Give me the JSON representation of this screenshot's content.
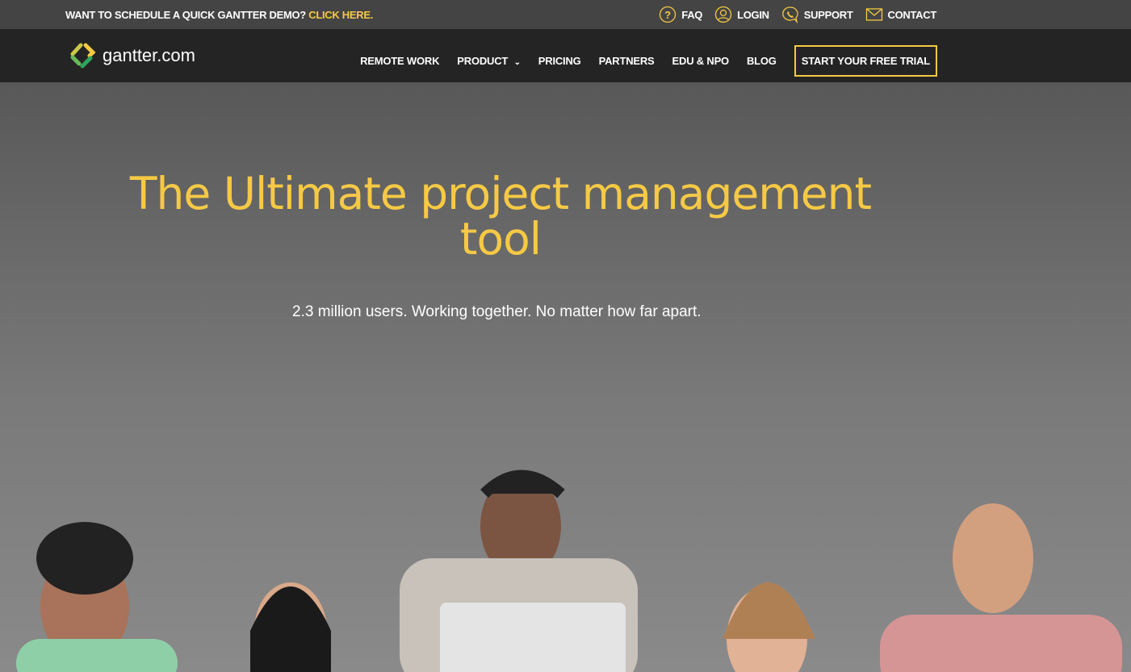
{
  "topbar": {
    "promo": "WANT TO SCHEDULE A QUICK GANTTER DEMO?",
    "promo_link": "CLICK HERE.",
    "links": [
      {
        "label": "FAQ",
        "icon": "question-circle-icon"
      },
      {
        "label": "LOGIN",
        "icon": "user-icon"
      },
      {
        "label": "SUPPORT",
        "icon": "phone-chat-icon"
      },
      {
        "label": "CONTACT",
        "icon": "envelope-icon"
      }
    ]
  },
  "nav": {
    "logo": "gantter.com",
    "items": [
      "REMOTE WORK",
      "PRODUCT",
      "PRICING",
      "PARTNERS",
      "EDU & NPO",
      "BLOG"
    ],
    "cta": "START YOUR FREE TRIAL"
  },
  "hero": {
    "title": "The Ultimate project management tool",
    "subtitle": "2.3 million users. Working together. No matter how far apart."
  },
  "colors": {
    "accent": "#f6c945",
    "nav_bg": "#242424",
    "topbar_bg": "#444444"
  }
}
